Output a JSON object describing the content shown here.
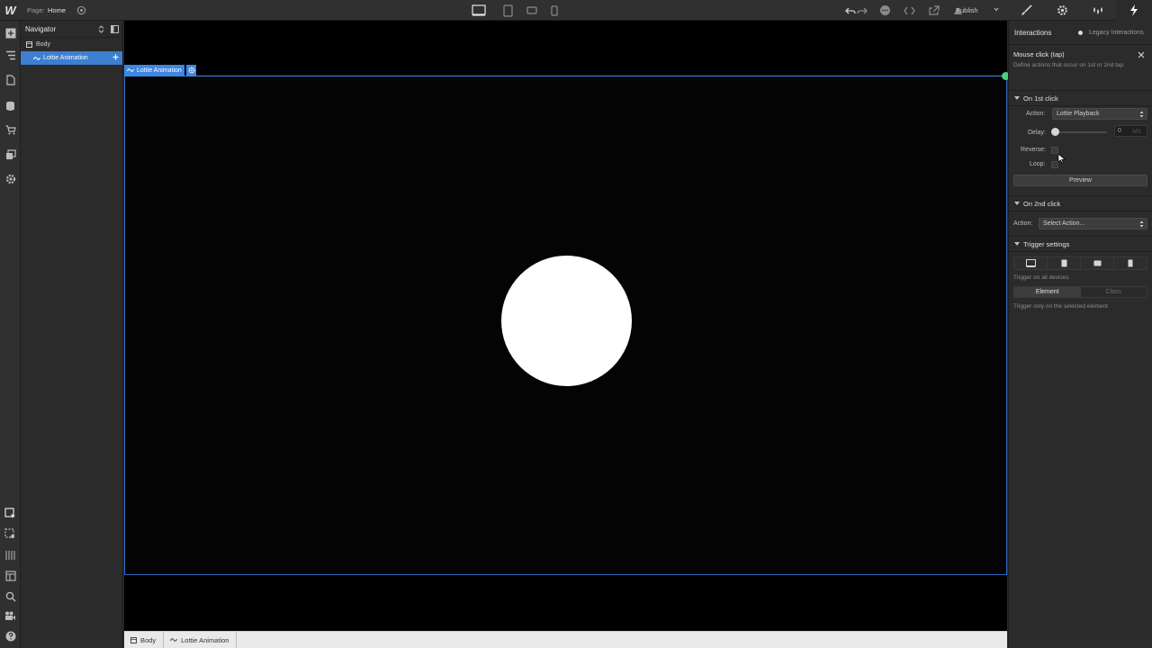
{
  "topbar": {
    "logo": "W",
    "page_label": "Page:",
    "page_name": "Home",
    "publish": "Publish"
  },
  "navigator": {
    "title": "Navigator",
    "items": [
      {
        "label": "Body",
        "icon": "box-icon"
      },
      {
        "label": "Lottie Animation",
        "icon": "lottie-icon",
        "selected": true
      }
    ]
  },
  "canvas": {
    "element_tag": "Lottie Animation",
    "shape": "white-circle"
  },
  "breadcrumbs": [
    "Body",
    "Lottie Animation"
  ],
  "panel": {
    "title": "Interactions",
    "legacy": "Legacy Interactions",
    "trigger": {
      "title": "Mouse click (tap)",
      "description": "Define actions that occur on 1st or 2nd tap."
    },
    "first_click": {
      "title": "On 1st click",
      "action_label": "Action:",
      "action_value": "Lottie Playback",
      "delay_label": "Delay:",
      "delay_value": "0",
      "delay_unit": "MS",
      "reverse_label": "Reverse:",
      "loop_label": "Loop:",
      "preview": "Preview"
    },
    "second_click": {
      "title": "On 2nd click",
      "action_label": "Action:",
      "action_value": "Select Action..."
    },
    "trigger_settings": {
      "title": "Trigger settings",
      "devices_note": "Trigger on all devices",
      "element": "Element",
      "class": "Class",
      "element_note": "Trigger only on the selected element"
    }
  },
  "colors": {
    "accent": "#3d86e3",
    "handle": "#4bd07a",
    "canvas": "#000000"
  }
}
